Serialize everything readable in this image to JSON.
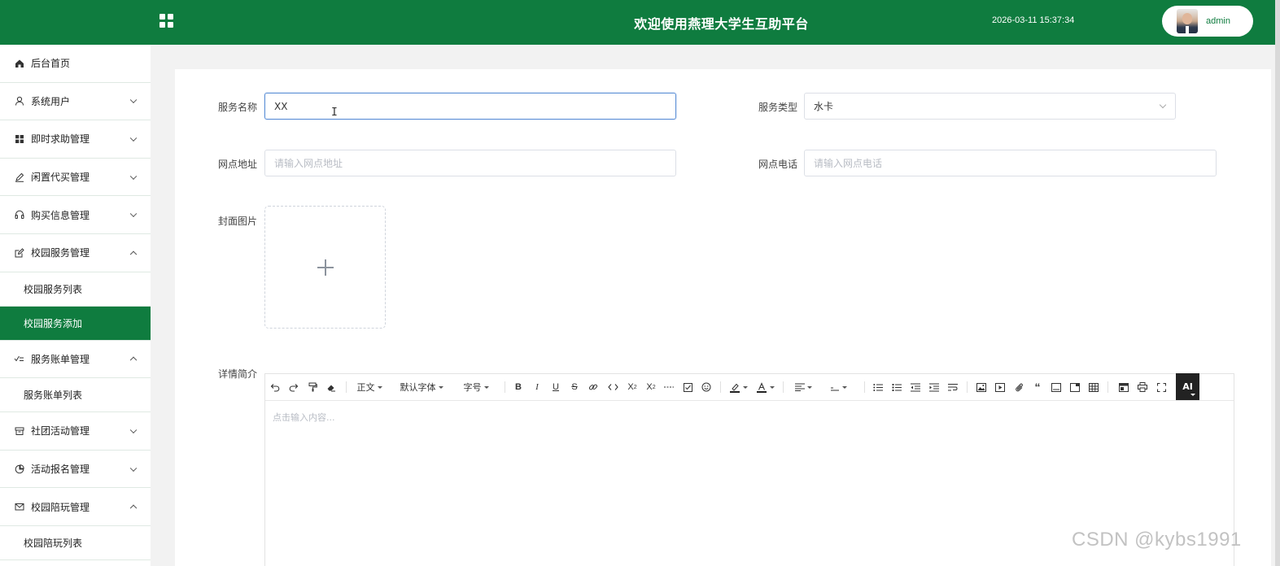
{
  "header": {
    "title": "欢迎使用燕理大学生互助平台",
    "datetime": "2026-03-11 15:37:34",
    "username": "admin",
    "bg_color": "#0f7c3f"
  },
  "sidebar": {
    "items": [
      {
        "label": "后台首页",
        "icon": "home-icon"
      },
      {
        "label": "系统用户",
        "icon": "user-icon",
        "expanded": false
      },
      {
        "label": "即时求助管理",
        "icon": "grid-icon",
        "expanded": false
      },
      {
        "label": "闲置代买管理",
        "icon": "edit-pen-icon",
        "expanded": false
      },
      {
        "label": "购买信息管理",
        "icon": "headset-icon",
        "expanded": false
      },
      {
        "label": "校园服务管理",
        "icon": "edit-box-icon",
        "expanded": true,
        "children": [
          "校园服务列表",
          "校园服务添加"
        ]
      },
      {
        "label": "服务账单管理",
        "icon": "checklist-icon",
        "expanded": true,
        "children": [
          "服务账单列表"
        ]
      },
      {
        "label": "社团活动管理",
        "icon": "box-icon",
        "expanded": false
      },
      {
        "label": "活动报名管理",
        "icon": "pie-icon",
        "expanded": false
      },
      {
        "label": "校园陪玩管理",
        "icon": "mail-icon",
        "expanded": true,
        "children": [
          "校园陪玩列表"
        ]
      }
    ],
    "active_item": "校园服务添加"
  },
  "form": {
    "service_name": {
      "label": "服务名称",
      "value": "XX"
    },
    "service_type": {
      "label": "服务类型",
      "value": "水卡"
    },
    "address": {
      "label": "网点地址",
      "placeholder": "请输入网点地址"
    },
    "phone": {
      "label": "网点电话",
      "placeholder": "请输入网点电话"
    },
    "cover": {
      "label": "封面图片"
    },
    "detail": {
      "label": "详情简介",
      "placeholder": "点击输入内容..."
    }
  },
  "editor_toolbar": {
    "paragraph": "正文",
    "font_family": "默认字体",
    "font_size": "字号",
    "ai": "AI"
  },
  "watermark": "CSDN @kybs1991"
}
